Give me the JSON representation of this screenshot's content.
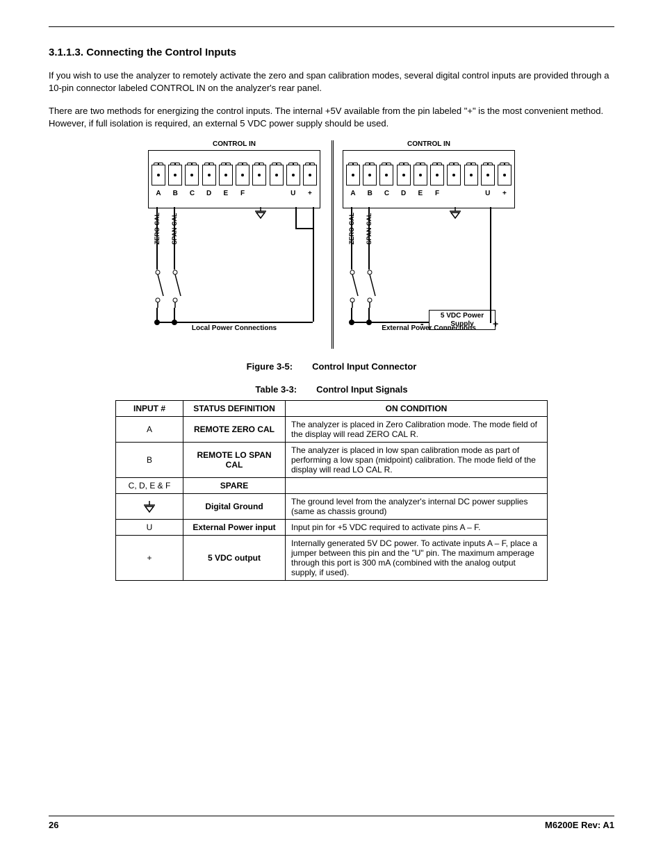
{
  "heading": "3.1.1.3. Connecting the Control Inputs",
  "para1": "If you wish to use the analyzer to remotely activate the zero and span calibration modes, several digital control inputs are provided through a 10-pin connector labeled CONTROL IN on the analyzer's rear panel.",
  "para2": "There are two methods for energizing the control inputs. The internal +5V available from the pin labeled \"+\" is the most convenient method. However, if full isolation is required, an external 5 VDC power supply should be used.",
  "diagram": {
    "connector_title": "CONTROL IN",
    "pins": [
      "A",
      "B",
      "C",
      "D",
      "E",
      "F",
      "",
      "",
      "U",
      "+"
    ],
    "zero_label": "ZERO CAL",
    "span_label": "SPAN CAL",
    "left_caption": "Local Power Connections",
    "right_caption": "External Power Connections",
    "psu_label": "5 VDC Power Supply",
    "psu_minus": "-",
    "psu_plus": "+"
  },
  "figure_caption_label": "Figure 3-5:",
  "figure_caption_text": "Control Input Connector",
  "table_caption_label": "Table 3-3:",
  "table_caption_text": "Control Input Signals",
  "table": {
    "headers": {
      "input": "INPUT #",
      "status": "STATUS DEFINITION",
      "cond": "ON CONDITION"
    },
    "rows": [
      {
        "input": "A",
        "status": "REMOTE ZERO CAL",
        "cond": "The analyzer is placed in Zero Calibration mode. The mode field of the display will read ZERO CAL R."
      },
      {
        "input": "B",
        "status": "REMOTE LO SPAN CAL",
        "cond": "The analyzer is placed in low span calibration mode as part of performing a low span (midpoint) calibration. The mode field of the display will read LO CAL R."
      },
      {
        "input": "C, D, E & F",
        "status": "SPARE",
        "cond": ""
      },
      {
        "input": "GND_ICON",
        "status": "Digital Ground",
        "cond": "The ground level from the analyzer's internal DC power supplies (same as chassis ground)"
      },
      {
        "input": "U",
        "status": "External Power input",
        "cond": "Input pin for +5 VDC required to activate pins A – F."
      },
      {
        "input": "+",
        "status": "5 VDC output",
        "cond": "Internally generated 5V DC power. To activate inputs A – F, place a jumper between this pin and the \"U\" pin. The maximum amperage through this port is 300 mA (combined with the analog output supply, if used)."
      }
    ]
  },
  "footer": {
    "page": "26",
    "rev": "M6200E Rev: A1"
  }
}
